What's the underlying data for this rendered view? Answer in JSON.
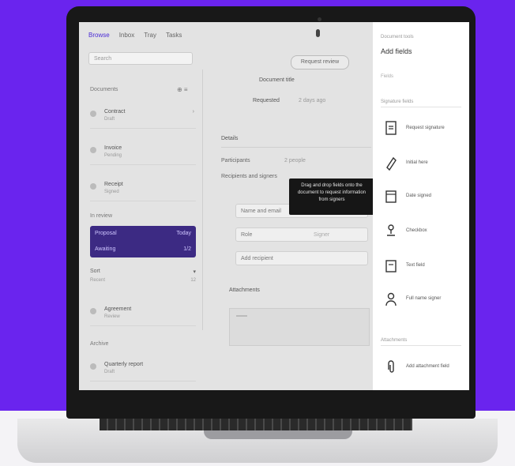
{
  "colors": {
    "background": "#6a24ee",
    "selected": "#3c2a83",
    "tooltip": "#161616",
    "panel": "#ffffff"
  },
  "menu": [
    "Browse",
    "Inbox",
    "Tray",
    "Tasks"
  ],
  "search_placeholder": "Search",
  "list": {
    "header": "Documents",
    "tools": "⊕ ≡",
    "items": [
      {
        "title": "Contract",
        "sub": "Draft"
      },
      {
        "title": "Invoice",
        "sub": "Pending"
      },
      {
        "title": "Receipt",
        "sub": "Signed"
      }
    ],
    "group_label": "In review",
    "selected": {
      "a": "Proposal",
      "b": "Today",
      "c": "Awaiting",
      "d": "1/2"
    },
    "mini": {
      "a": "Sort",
      "b": "▾",
      "c": "Recent",
      "d": "12"
    },
    "item_lower": {
      "title": "Agreement",
      "sub": "Review"
    },
    "group_label2": "Archive",
    "item_last": {
      "title": "Quarterly report",
      "sub": "Draft"
    }
  },
  "detail": {
    "button": "Request review",
    "line1": "Document title",
    "line2a": "Requested",
    "line2b": "2 days ago",
    "section": "Details",
    "field1_label": "Participants",
    "field1_value": "2 people",
    "field2_label": "Recipients and signers",
    "input1": "Name and email",
    "input2a": "Role",
    "input2b": "Signer",
    "input3": "Add recipient",
    "attachments": "Attachments"
  },
  "tooltip": "Drag and drop fields onto the document to request information from signers",
  "panel": {
    "small": "Document tools",
    "title": "Add fields",
    "sub": "Fields",
    "section1": "Signature fields",
    "tools": [
      {
        "label": "Request signature",
        "icon": "signature-icon"
      },
      {
        "label": "Initial here",
        "icon": "initial-icon"
      },
      {
        "label": "Date signed",
        "icon": "calendar-icon"
      },
      {
        "label": "Checkbox",
        "icon": "stamp-icon"
      },
      {
        "label": "Text field",
        "icon": "textfield-icon"
      },
      {
        "label": "Full name signer",
        "icon": "person-icon"
      }
    ],
    "section2": "Attachments",
    "tool_last": {
      "label": "Add attachment field",
      "icon": "attachment-icon"
    }
  }
}
